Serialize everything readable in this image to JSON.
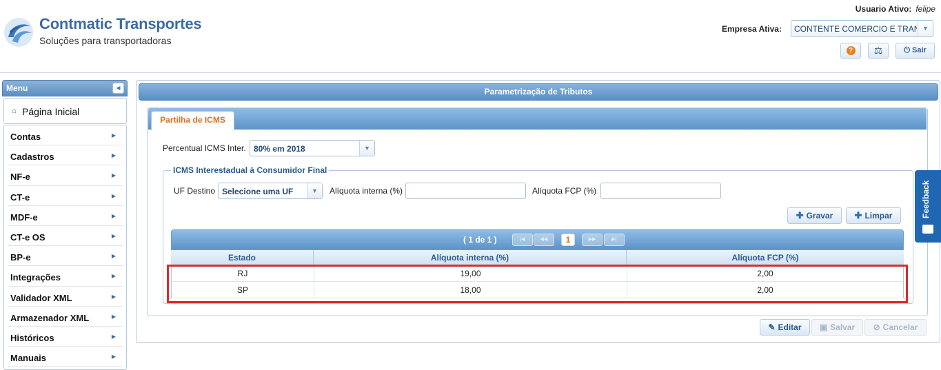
{
  "header": {
    "brand_title": "Contmatic Transportes",
    "brand_subtitle": "Soluções para transportadoras",
    "user_label": "Usuario Ativo:",
    "user_value": "felipe",
    "empresa_label": "Empresa Ativa:",
    "empresa_value": "CONTENTE COMERCIO E TRANSPORTES",
    "help_icon": "?",
    "sair_label": "Sair"
  },
  "sidebar": {
    "title": "Menu",
    "home_label": "Página Inicial",
    "items": [
      {
        "label": "Contas"
      },
      {
        "label": "Cadastros"
      },
      {
        "label": "NF-e"
      },
      {
        "label": "CT-e"
      },
      {
        "label": "MDF-e"
      },
      {
        "label": "CT-e OS"
      },
      {
        "label": "BP-e"
      },
      {
        "label": "Integrações"
      },
      {
        "label": "Validador XML"
      },
      {
        "label": "Armazenador XML"
      },
      {
        "label": "Históricos"
      },
      {
        "label": "Manuais"
      }
    ]
  },
  "main": {
    "panel_title": "Parametrização de Tributos",
    "tab_label": "Partilha de ICMS",
    "percentual_label": "Percentual ICMS Inter.",
    "percentual_value": "80% em 2018",
    "fieldset_legend": "ICMS Interestadual à Consumidor Final",
    "uf_label": "UF Destino",
    "uf_value": "Selecione uma UF",
    "aliquota_interna_label": "Alíquota interna (%)",
    "aliquota_fcp_label": "Alíquota FCP (%)",
    "gravar_label": "Gravar",
    "limpar_label": "Limpar",
    "pager_text": "( 1 de 1 )",
    "pager_page": "1",
    "columns": [
      "Estado",
      "Alíquota interna (%)",
      "Alíquota FCP (%)"
    ],
    "rows": [
      [
        "RJ",
        "19,00",
        "2,00"
      ],
      [
        "SP",
        "18,00",
        "2,00"
      ]
    ],
    "editar_label": "Editar",
    "salvar_label": "Salvar",
    "cancelar_label": "Cancelar"
  },
  "feedback": {
    "label": "Feedback"
  },
  "colors": {
    "accent": "#5a8fc4",
    "tab_active": "#e0701c",
    "highlight": "#d92b2b",
    "feedback": "#2067b3"
  }
}
